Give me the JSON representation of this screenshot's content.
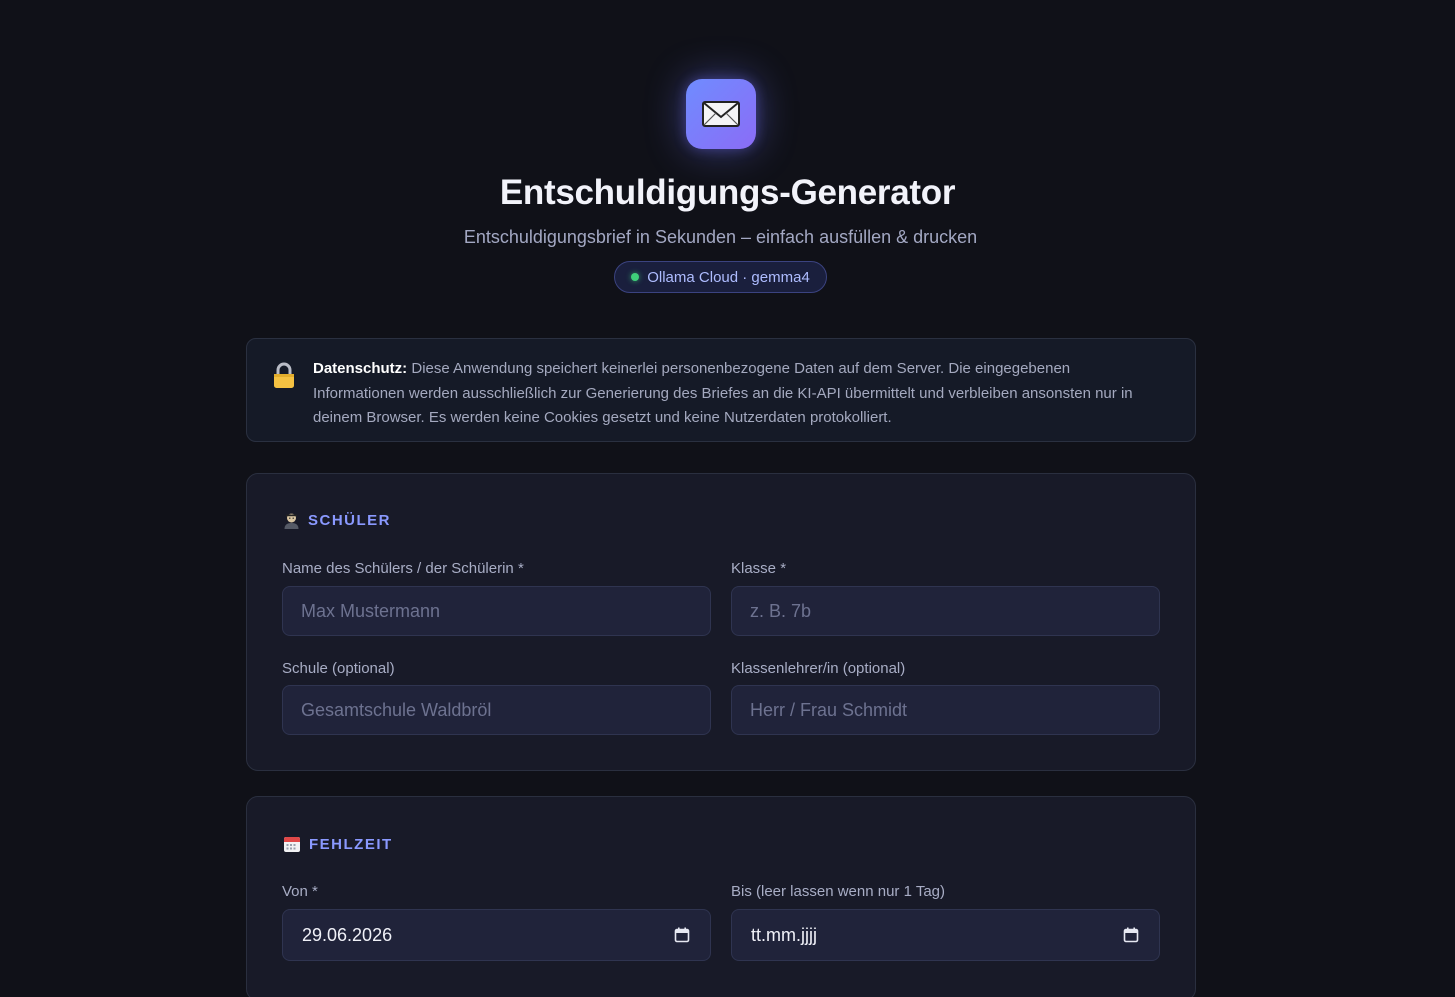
{
  "header": {
    "logo_icon": "envelope-icon",
    "title": "Entschuldigungs-Generator",
    "subtitle": "Entschuldigungsbrief in Sekunden – einfach ausfüllen & drucken",
    "badge": "Ollama Cloud · gemma4",
    "badge_status_color": "#3fcf7a"
  },
  "privacy": {
    "icon": "lock-icon",
    "label": "Datenschutz:",
    "text": "Diese Anwendung speichert keinerlei personenbezogene Daten auf dem Server. Die eingegebenen Informationen werden ausschließlich zur Generierung des Briefes an die KI-API übermittelt und verbleiben ansonsten nur in deinem Browser. Es werden keine Cookies gesetzt und keine Nutzerdaten protokolliert."
  },
  "student": {
    "icon": "student-icon",
    "heading": "SCHÜLER",
    "name_label": "Name des Schülers / der Schülerin *",
    "name_placeholder": "Max Mustermann",
    "class_label": "Klasse *",
    "class_placeholder": "z. B. 7b",
    "school_label": "Schule (optional)",
    "school_placeholder": "Gesamtschule Waldbröl",
    "teacher_label": "Klassenlehrer/in (optional)",
    "teacher_placeholder": "Herr / Frau Schmidt"
  },
  "absence": {
    "icon": "calendar-icon",
    "heading": "FEHLZEIT",
    "from_label": "Von *",
    "from_value": "29.06.2026",
    "to_label": "Bis (leer lassen wenn nur 1 Tag)",
    "to_value": "tt.mm.jjjj"
  },
  "colors": {
    "accent": "#8a99ff",
    "background": "#101118",
    "card": "#181a28"
  }
}
